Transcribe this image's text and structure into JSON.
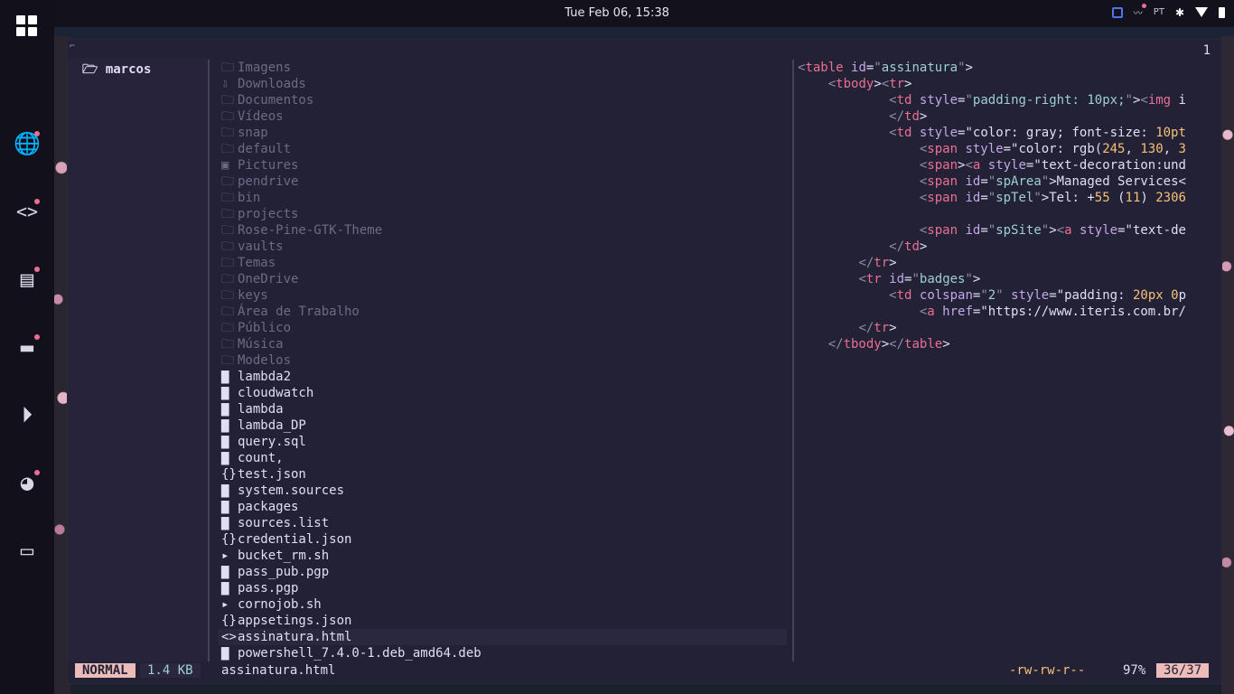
{
  "topbar": {
    "datetime": "Tue Feb 06, 15:38",
    "keyboard_layout": "PT"
  },
  "dock": {
    "items": [
      {
        "name": "app-grid-icon"
      },
      {
        "name": "globe-icon",
        "badge": true
      },
      {
        "name": "code-icon",
        "badge": true
      },
      {
        "name": "chat-icon",
        "badge": true
      },
      {
        "name": "folder-icon",
        "badge": true
      },
      {
        "name": "play-icon",
        "badge": false
      },
      {
        "name": "palette-icon",
        "badge": true
      },
      {
        "name": "gamepad-icon",
        "badge": false
      }
    ]
  },
  "parent_pane": {
    "current_dir": "marcos"
  },
  "files": [
    {
      "name": "Imagens",
      "type": "dir",
      "icon": "🗀"
    },
    {
      "name": "Downloads",
      "type": "dir",
      "icon": "⇩"
    },
    {
      "name": "Documentos",
      "type": "dir",
      "icon": "🗀"
    },
    {
      "name": "Vídeos",
      "type": "dir",
      "icon": "🗀"
    },
    {
      "name": "snap",
      "type": "dir",
      "icon": "🗀"
    },
    {
      "name": "default",
      "type": "dir",
      "icon": "🗀"
    },
    {
      "name": "Pictures",
      "type": "dir",
      "icon": "▣"
    },
    {
      "name": "pendrive",
      "type": "dir",
      "icon": "🗀"
    },
    {
      "name": "bin",
      "type": "dir",
      "icon": "🗀"
    },
    {
      "name": "projects",
      "type": "dir",
      "icon": "🗀"
    },
    {
      "name": "Rose-Pine-GTK-Theme",
      "type": "dir",
      "icon": "🗀"
    },
    {
      "name": "vaults",
      "type": "dir",
      "icon": "🗀"
    },
    {
      "name": "Temas",
      "type": "dir",
      "icon": "🗀"
    },
    {
      "name": "OneDrive",
      "type": "dir",
      "icon": "🗀"
    },
    {
      "name": "keys",
      "type": "dir",
      "icon": "🗀"
    },
    {
      "name": "Área de Trabalho",
      "type": "dir",
      "icon": "🗀"
    },
    {
      "name": "Público",
      "type": "dir",
      "icon": "🗀"
    },
    {
      "name": "Música",
      "type": "dir",
      "icon": "🗀"
    },
    {
      "name": "Modelos",
      "type": "dir",
      "icon": "🗀"
    },
    {
      "name": "lambda2",
      "type": "file",
      "icon": "▇"
    },
    {
      "name": "cloudwatch",
      "type": "file",
      "icon": "▇"
    },
    {
      "name": "lambda",
      "type": "file",
      "icon": "▇"
    },
    {
      "name": "lambda_DP",
      "type": "file",
      "icon": "▇"
    },
    {
      "name": "query.sql",
      "type": "file",
      "icon": "▇"
    },
    {
      "name": "count,",
      "type": "file",
      "icon": "▇"
    },
    {
      "name": "test.json",
      "type": "file",
      "icon": "{}"
    },
    {
      "name": "system.sources",
      "type": "file",
      "icon": "▇"
    },
    {
      "name": "packages",
      "type": "file",
      "icon": "▇"
    },
    {
      "name": "sources.list",
      "type": "file",
      "icon": "▇"
    },
    {
      "name": "credential.json",
      "type": "file",
      "icon": "{}"
    },
    {
      "name": "bucket_rm.sh",
      "type": "file",
      "icon": "▸"
    },
    {
      "name": "pass_pub.pgp",
      "type": "file",
      "icon": "▇"
    },
    {
      "name": "pass.pgp",
      "type": "file",
      "icon": "▇"
    },
    {
      "name": "cornojob.sh",
      "type": "file",
      "icon": "▸"
    },
    {
      "name": "appsetings.json",
      "type": "file",
      "icon": "{}"
    },
    {
      "name": "assinatura.html",
      "type": "file",
      "icon": "<>",
      "selected": true
    },
    {
      "name": "powershell_7.4.0-1.deb_amd64.deb",
      "type": "file",
      "icon": "▇"
    }
  ],
  "preview": {
    "line_number": "1",
    "lines": [
      "<table id=\"assinatura\">",
      "    <tbody><tr>",
      "            <td style=\"padding-right: 10px;\"><img i",
      "            </td>",
      "            <td style=\"color: gray; font-size: 10pt",
      "                <span style=\"color: rgb(245, 130, 3",
      "                <span><a style=\"text-decoration:und",
      "                <span id=\"spArea\">Managed Services<",
      "                <span id=\"spTel\">Tel: +55 (11) 2306",
      "",
      "                <span id=\"spSite\"><a style=\"text-de",
      "            </td>",
      "        </tr>",
      "        <tr id=\"badges\">",
      "            <td colspan=\"2\" style=\"padding: 20px 0p",
      "                <a href=\"https://www.iteris.com.br/",
      "        </tr>",
      "    </tbody></table>"
    ]
  },
  "statusbar": {
    "mode": "NORMAL",
    "file_size": "1.4 KB",
    "filename": "assinatura.html",
    "permissions": "-rw-rw-r--",
    "percent": "97%",
    "position": "36/37"
  },
  "colors": {
    "accent": "#ebbcba",
    "love": "#eb6f92",
    "foam": "#9ccfd8",
    "iris": "#c4a7e7",
    "gold": "#f6c177",
    "muted": "#6e6a86",
    "base": "#232136"
  }
}
